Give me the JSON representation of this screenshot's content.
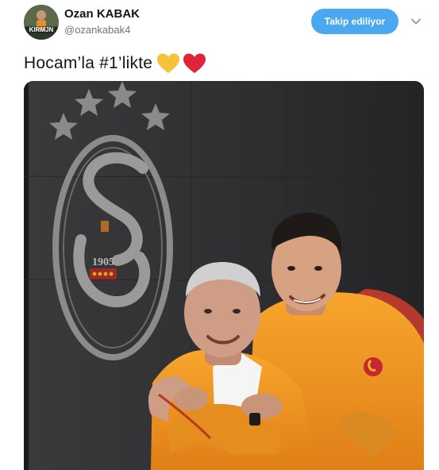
{
  "tweet": {
    "author": {
      "display_name": "Ozan KABAK",
      "handle": "@ozankabak4",
      "avatar_caption": "KIRMJN"
    },
    "follow_button_label": "Takip ediliyor",
    "text": "Hocam’la #1’likte",
    "emojis": [
      "yellow-heart",
      "red-heart"
    ],
    "media": {
      "description_icon": "photo",
      "crest_year": "1905"
    }
  },
  "colors": {
    "follow_button": "#4aa8f0",
    "handle_gray": "#657786",
    "jersey_orange": "#f39a23",
    "yellow_heart": "#f7c23a",
    "red_heart": "#e0243a"
  }
}
